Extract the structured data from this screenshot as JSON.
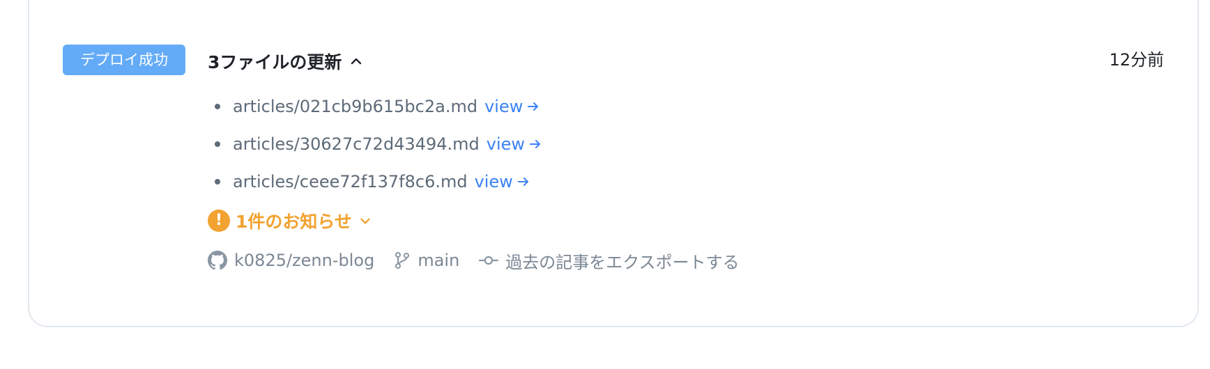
{
  "deploy": {
    "status_badge": "デプロイ成功",
    "title": "3ファイルの更新",
    "time_ago": "12分前",
    "files": [
      {
        "path": "articles/021cb9b615bc2a.md",
        "link_label": "view"
      },
      {
        "path": "articles/30627c72d43494.md",
        "link_label": "view"
      },
      {
        "path": "articles/ceee72f137f8c6.md",
        "link_label": "view"
      }
    ],
    "notice": {
      "icon_glyph": "!",
      "label": "1件のお知らせ"
    },
    "meta": {
      "repository": "k0825/zenn-blog",
      "branch": "main",
      "commit_message": "過去の記事をエクスポートする"
    }
  },
  "colors": {
    "badge_bg": "#64abf7",
    "link": "#3b82f6",
    "notice": "#f2a230",
    "muted": "#7b8794"
  },
  "icons": {
    "title_toggle": "chevron-up-icon",
    "link_arrow": "arrow-right-icon",
    "notice_toggle": "chevron-down-icon",
    "repository": "github-icon",
    "branch": "git-branch-icon",
    "commit": "git-commit-icon"
  }
}
